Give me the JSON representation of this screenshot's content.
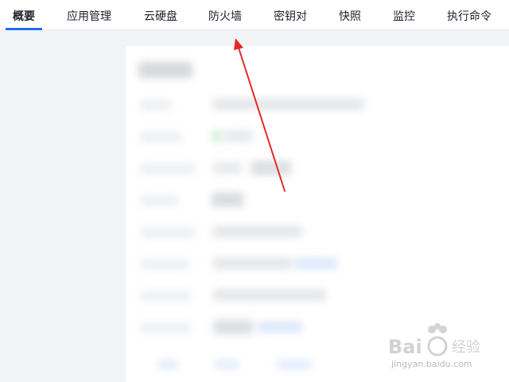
{
  "tabs": [
    {
      "label": "概要",
      "active": true
    },
    {
      "label": "应用管理",
      "active": false
    },
    {
      "label": "云硬盘",
      "active": false
    },
    {
      "label": "防火墙",
      "active": false
    },
    {
      "label": "密钥对",
      "active": false
    },
    {
      "label": "快照",
      "active": false
    },
    {
      "label": "监控",
      "active": false
    },
    {
      "label": "执行命令",
      "active": false
    }
  ],
  "colors": {
    "accent": "#1f6ee8",
    "annotation_arrow": "#e02b2b",
    "background": "#f2f3f5",
    "panel": "#ffffff"
  },
  "watermark": {
    "logo_text": "Bai 经验",
    "url": "jingyan.baidu.com"
  }
}
